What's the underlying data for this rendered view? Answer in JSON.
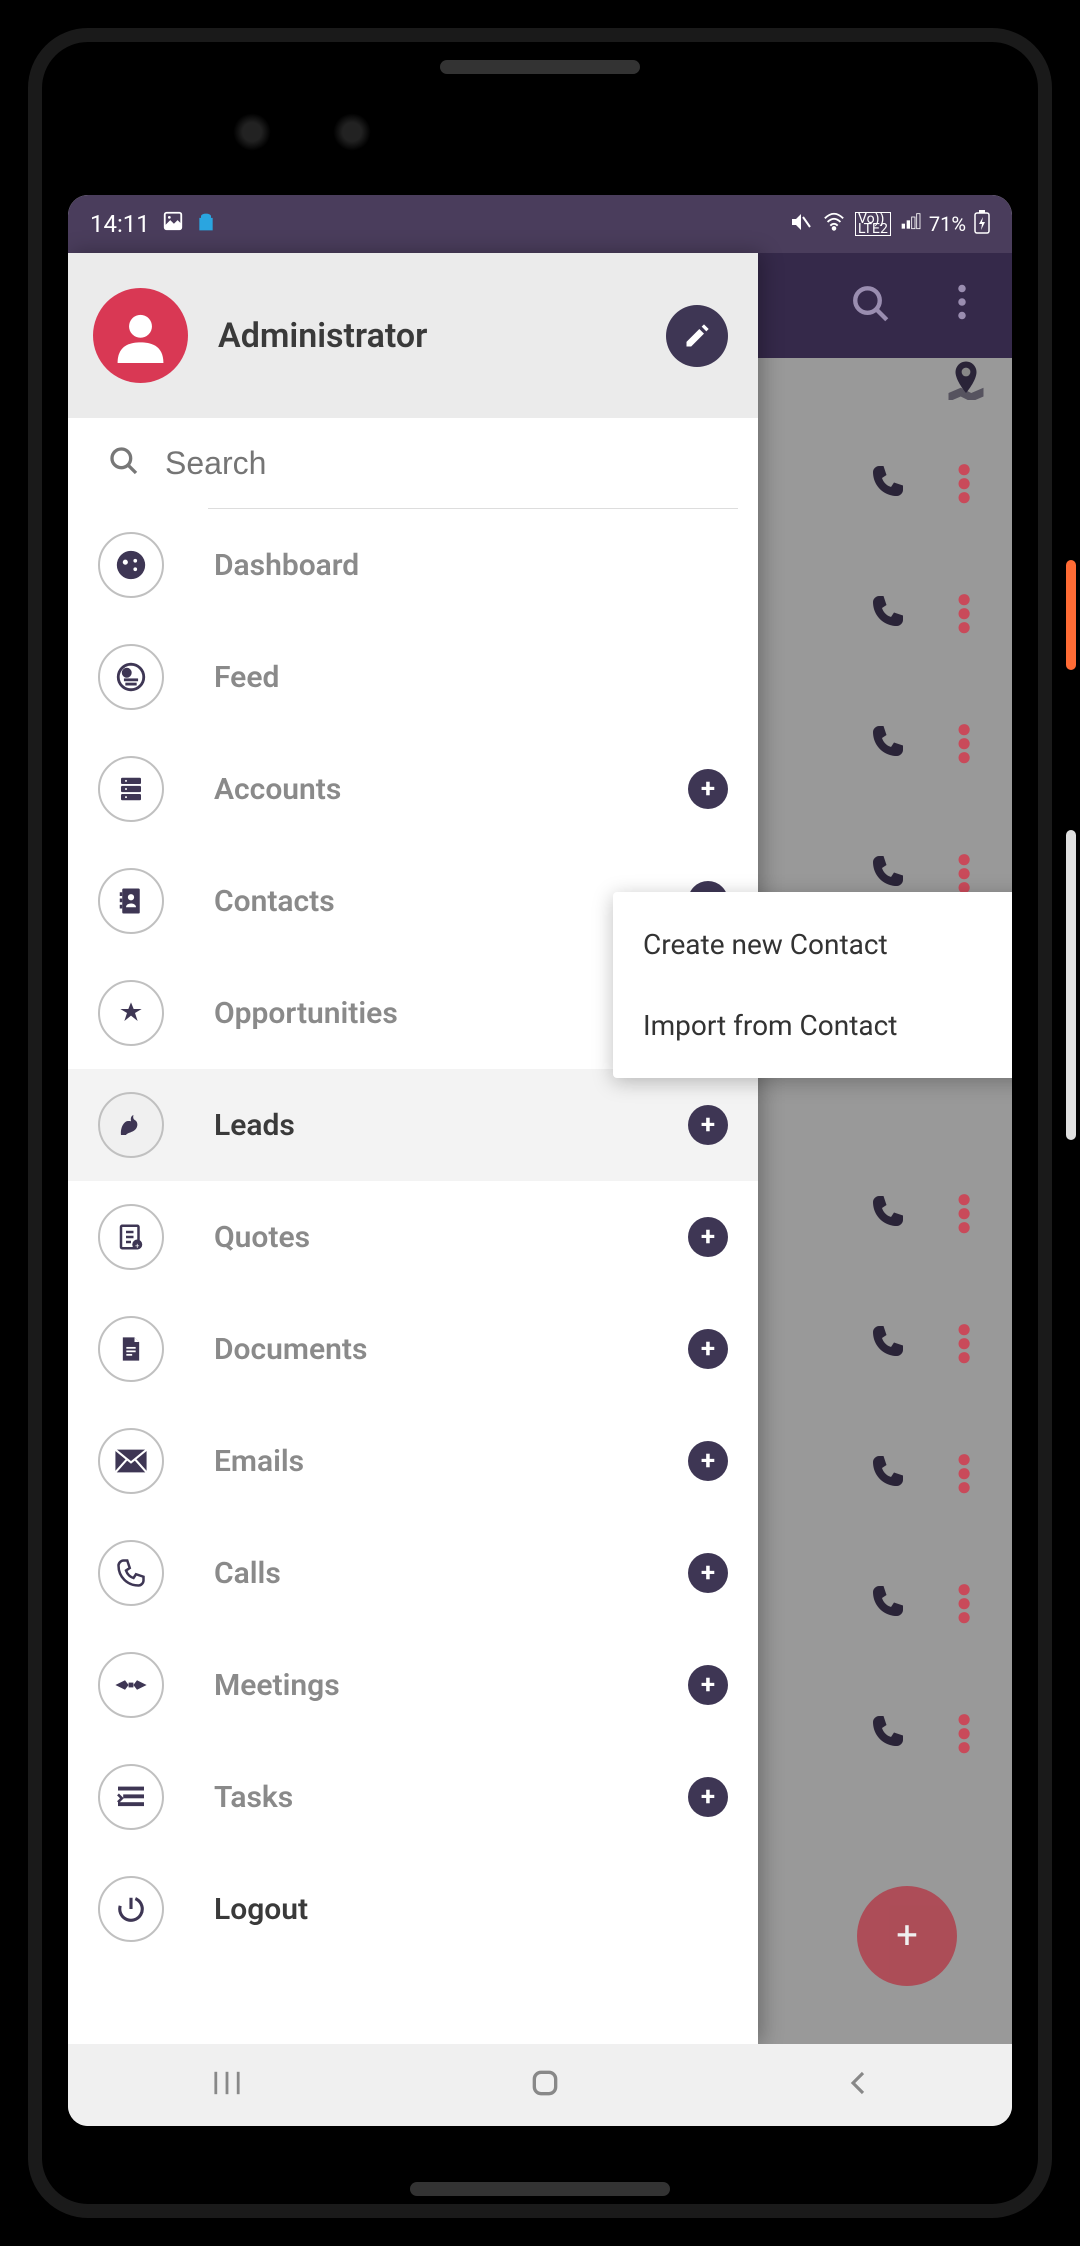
{
  "status": {
    "time": "14:11",
    "battery": "71%"
  },
  "drawer": {
    "user_name": "Administrator",
    "search_placeholder": "Search",
    "items": [
      {
        "label": "Dashboard",
        "icon": "dashboard",
        "has_add": false
      },
      {
        "label": "Feed",
        "icon": "feed",
        "has_add": false
      },
      {
        "label": "Accounts",
        "icon": "accounts",
        "has_add": true
      },
      {
        "label": "Contacts",
        "icon": "contacts",
        "has_add": true
      },
      {
        "label": "Opportunities",
        "icon": "opportunities",
        "has_add": false
      },
      {
        "label": "Leads",
        "icon": "leads",
        "has_add": true,
        "active": true
      },
      {
        "label": "Quotes",
        "icon": "quotes",
        "has_add": true
      },
      {
        "label": "Documents",
        "icon": "documents",
        "has_add": true
      },
      {
        "label": "Emails",
        "icon": "emails",
        "has_add": true
      },
      {
        "label": "Calls",
        "icon": "calls",
        "has_add": true
      },
      {
        "label": "Meetings",
        "icon": "meetings",
        "has_add": true
      },
      {
        "label": "Tasks",
        "icon": "tasks",
        "has_add": true
      },
      {
        "label": "Logout",
        "icon": "logout",
        "has_add": false
      }
    ]
  },
  "popup": {
    "items": [
      "Create new Contact",
      "Import from Contact"
    ]
  },
  "colors": {
    "primary_dark": "#3e3654",
    "accent_red": "#d93854",
    "status_bg": "#4a3d5c"
  }
}
